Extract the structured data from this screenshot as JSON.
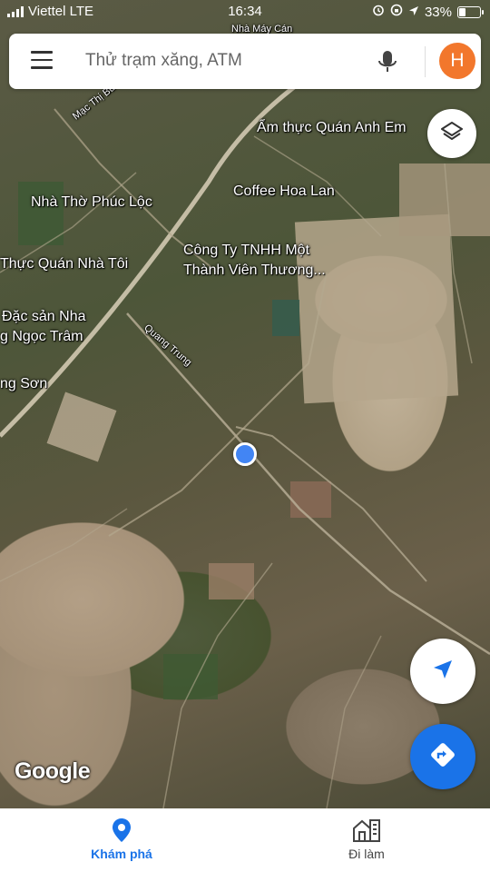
{
  "status_bar": {
    "carrier": "Viettel LTE",
    "time": "16:34",
    "battery": "33%"
  },
  "search": {
    "placeholder": "Thử trạm xăng, ATM",
    "avatar_letter": "H",
    "avatar_color": "#f2772c"
  },
  "map": {
    "labels": [
      "Nhà Máy Cán",
      "Ẩm thực Quán Anh Em",
      "Mạc Thị Bưởi",
      "Nhà Thờ Phúc Lộc",
      "Coffee Hoa Lan",
      "Công Ty TNHH Một",
      "Thành Viên Thương...",
      "Thực Quán Nhà Tôi",
      "Đặc sản Nha",
      "g Ngọc Trâm",
      "Quang Trung",
      "ng Sơn"
    ],
    "attribution": "Google"
  },
  "icons": {
    "menu": "menu-icon",
    "mic": "mic-icon",
    "layers": "layers-icon",
    "my_location": "navigation-arrow-icon",
    "directions": "directions-icon",
    "explore": "place-pin-icon",
    "commute": "commute-icon"
  },
  "colors": {
    "accent": "#1a73e8",
    "location_dot": "#4285f4"
  },
  "bottom_nav": {
    "tabs": [
      {
        "label": "Khám phá",
        "active": true
      },
      {
        "label": "Đi làm",
        "active": false
      }
    ]
  }
}
